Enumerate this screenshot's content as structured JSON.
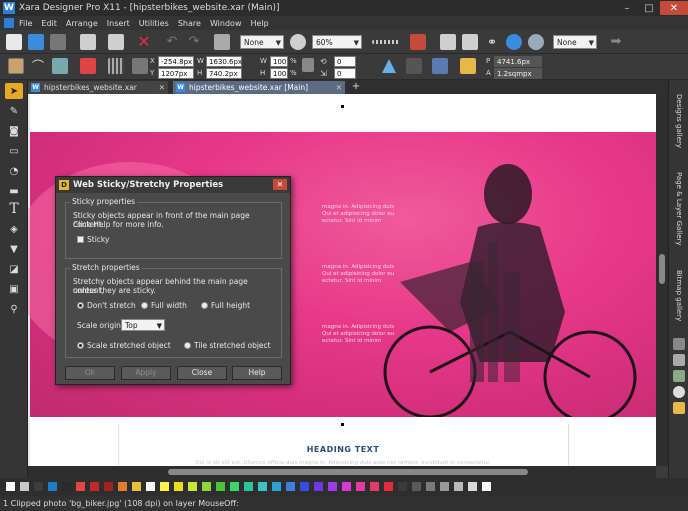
{
  "window": {
    "app_logo": "W",
    "title": "Xara Designer Pro X11 - [hipsterbikes_website.xar (Main)]",
    "minimize": "–",
    "maximize": "□",
    "close": "✕"
  },
  "menu": [
    "File",
    "Edit",
    "Arrange",
    "Insert",
    "Utilities",
    "Share",
    "Window",
    "Help"
  ],
  "toolbar": {
    "quality_value": "None",
    "zoom_value": "60%",
    "snap_value": "None"
  },
  "infobar": {
    "x_label": "X",
    "x_value": "-254.8px",
    "y_label": "Y",
    "y_value": "1207px",
    "w_label": "W",
    "w_value": "1630.6px",
    "h_label": "H",
    "h_value": "740.2px",
    "scale_w_value": "100",
    "scale_h_value": "100",
    "scale_unit": "%",
    "rotate_value": "0",
    "skew_value": "0",
    "p_label": "P",
    "p_value": "4741.6px",
    "a_label": "A",
    "a_value": "1.2sqmpx"
  },
  "tabs": [
    {
      "label": "hipsterbikes_website.xar [Smart...",
      "close": "✕"
    },
    {
      "label": "hipsterbikes_website.xar [Main]",
      "close": "✕"
    }
  ],
  "tab_add": "+",
  "galleries": [
    "Designs gallery",
    "Page & Layer Gallery",
    "Bitmap gallery"
  ],
  "canvas": {
    "hero_lines_1": [
      "magna in. Adipisicing duis",
      "Qui et adipisicing dolor eu",
      "ectetur. Sint id minim"
    ],
    "hero_lines_2": [
      "magna in. Adipisicing duis",
      "Qui et adipisicing dolor eu",
      "ectetur. Sint id minim"
    ],
    "hero_lines_3": [
      "magna in. Adipisicing duis",
      "Qui et adipisicing dolor eu",
      "ectetur. Sint id minim"
    ],
    "heading": "HEADING TEXT",
    "body_fade": "Qui in sit elit est. Ullamco officia duis magna in. Adipisicing duis aute nisi tempor. Incididunt in consectetur."
  },
  "dialog": {
    "logo": "D",
    "title": "Web Sticky/Stretchy Properties",
    "close": "✕",
    "sticky": {
      "title": "Sticky properties",
      "desc_1": "Sticky objects appear in front of the main page content.",
      "desc_2": "Click Help for more info.",
      "checkbox_label": "Sticky"
    },
    "stretch": {
      "title": "Stretch properties",
      "desc_1": "Stretchy objects appear behind the main page content,",
      "desc_2": "unless they are sticky.",
      "dont_stretch": "Don't stretch",
      "full_width": "Full width",
      "full_height": "Full height",
      "origin_label": "Scale origin",
      "origin_value": "Top",
      "scale_stretched": "Scale stretched object",
      "tile_stretched": "Tile stretched object"
    },
    "buttons": {
      "ok": "Ok",
      "apply": "Apply",
      "close": "Close",
      "help": "Help"
    }
  },
  "palette_colors": [
    "#ffffff",
    "#c8c8c8",
    "#3d3d3d",
    "#1d7fc1",
    "#2a2a2a",
    "#e64545",
    "#c02a2a",
    "#a52020",
    "#e87a30",
    "#e3c23a",
    "#f5f5f5",
    "#fff04a",
    "#e8e01a",
    "#c8e63a",
    "#8ed63a",
    "#4ac43a",
    "#3ad66a",
    "#2ac49a",
    "#3ac4c4",
    "#2aa2d6",
    "#3a7ee6",
    "#3a4ae6",
    "#6a3ae6",
    "#a03ae6",
    "#d63ad6",
    "#e63aa0",
    "#e63a6a",
    "#e62a3a",
    "#3a3a3a",
    "#5a5a5a",
    "#7a7a7a",
    "#9a9a9a",
    "#bababa",
    "#dadada",
    "#fafafa"
  ],
  "status": "1 Clipped photo 'bg_biker.jpg' (108 dpi) on layer MouseOff:"
}
